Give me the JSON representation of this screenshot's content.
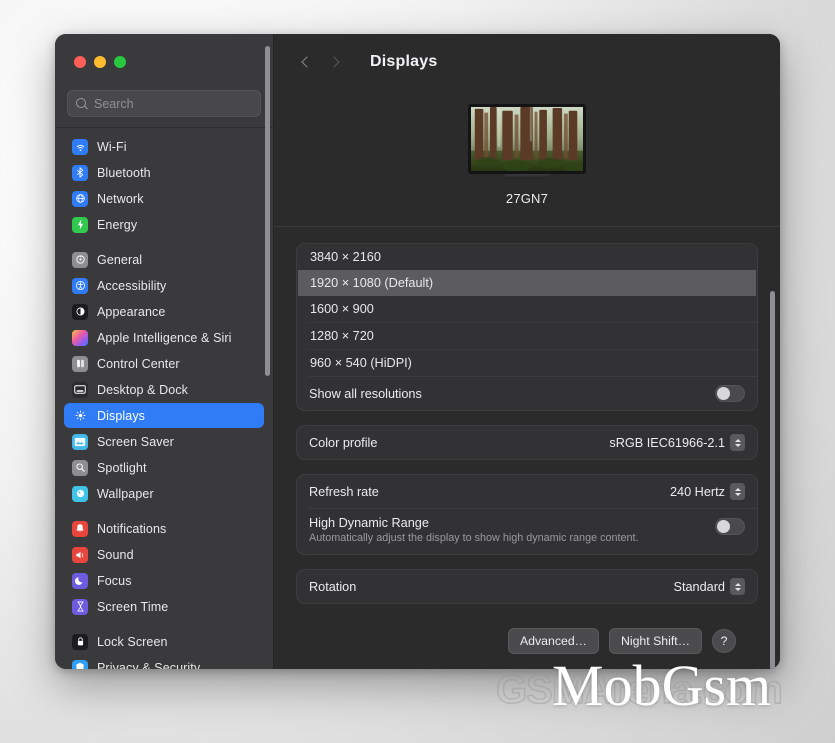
{
  "window": {
    "traffic_lights": [
      "close",
      "minimize",
      "zoom"
    ]
  },
  "search": {
    "placeholder": "Search",
    "value": "",
    "icon": "search-icon"
  },
  "sidebar": {
    "groups": [
      {
        "items": [
          {
            "label": "Wi-Fi",
            "icon": "wifi-icon",
            "color": "#2f7cf6"
          },
          {
            "label": "Bluetooth",
            "icon": "bluetooth-icon",
            "color": "#2f7cf6"
          },
          {
            "label": "Network",
            "icon": "network-icon",
            "color": "#2f7cf6"
          },
          {
            "label": "Energy",
            "icon": "energy-icon",
            "color": "#30c94e"
          }
        ]
      },
      {
        "items": [
          {
            "label": "General",
            "icon": "gear-icon",
            "color": "#8e8e93"
          },
          {
            "label": "Accessibility",
            "icon": "accessibility-icon",
            "color": "#2f7cf6"
          },
          {
            "label": "Appearance",
            "icon": "appearance-icon",
            "color": "#1c1c1e"
          },
          {
            "label": "Apple Intelligence & Siri",
            "icon": "siri-icon",
            "color": "#e06cc0"
          },
          {
            "label": "Control Center",
            "icon": "control-center-icon",
            "color": "#8e8e93"
          },
          {
            "label": "Desktop & Dock",
            "icon": "desktop-dock-icon",
            "color": "#2c2c2e"
          },
          {
            "label": "Displays",
            "icon": "displays-icon",
            "color": "#2f7cf6",
            "selected": true
          },
          {
            "label": "Screen Saver",
            "icon": "screen-saver-icon",
            "color": "#41b8e8"
          },
          {
            "label": "Spotlight",
            "icon": "spotlight-icon",
            "color": "#8e8e93"
          },
          {
            "label": "Wallpaper",
            "icon": "wallpaper-icon",
            "color": "#41c3e8"
          }
        ]
      },
      {
        "items": [
          {
            "label": "Notifications",
            "icon": "notifications-icon",
            "color": "#e8453c"
          },
          {
            "label": "Sound",
            "icon": "sound-icon",
            "color": "#e8453c"
          },
          {
            "label": "Focus",
            "icon": "focus-icon",
            "color": "#6e5ce0"
          },
          {
            "label": "Screen Time",
            "icon": "screen-time-icon",
            "color": "#6e5ce0"
          }
        ]
      },
      {
        "items": [
          {
            "label": "Lock Screen",
            "icon": "lock-screen-icon",
            "color": "#1c1c1e"
          },
          {
            "label": "Privacy & Security",
            "icon": "privacy-security-icon",
            "color": "#2f9ef6"
          }
        ]
      }
    ]
  },
  "toolbar": {
    "back_icon": "chevron-left-icon",
    "forward_icon": "chevron-right-icon",
    "title": "Displays"
  },
  "display_preview": {
    "name": "27GN7"
  },
  "resolutions": {
    "options": [
      {
        "label": "3840 × 2160",
        "selected": false
      },
      {
        "label": "1920 × 1080 (Default)",
        "selected": true
      },
      {
        "label": "1600 × 900",
        "selected": false
      },
      {
        "label": "1280 × 720",
        "selected": false
      },
      {
        "label": "960 × 540 (HiDPI)",
        "selected": false
      }
    ],
    "show_all_label": "Show all resolutions",
    "show_all_on": false
  },
  "settings": {
    "color_profile": {
      "label": "Color profile",
      "value": "sRGB IEC61966-2.1"
    },
    "refresh_rate": {
      "label": "Refresh rate",
      "value": "240 Hertz"
    },
    "hdr": {
      "label": "High Dynamic Range",
      "description": "Automatically adjust the display to show high dynamic range content.",
      "on": false
    },
    "rotation": {
      "label": "Rotation",
      "value": "Standard"
    }
  },
  "footer": {
    "advanced_label": "Advanced…",
    "night_shift_label": "Night Shift…",
    "help_label": "?"
  },
  "watermarks": {
    "primary": "MobGsm",
    "secondary": "GSMArena.com"
  },
  "colors": {
    "accent": "#2f7cf6",
    "window_bg": "#2b2b2b",
    "sidebar_bg": "#3a3a3c",
    "card_bg": "#323234",
    "selected_row": "#5c5c5e"
  }
}
